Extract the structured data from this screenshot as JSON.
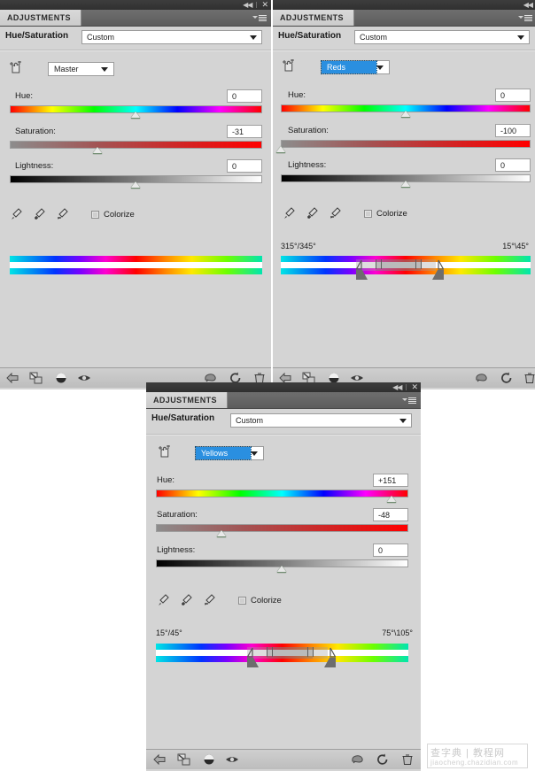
{
  "app": {
    "panel_tab_label": "ADJUSTMENTS",
    "titlebar": {
      "collapse_icon": "collapse-double-arrow-icon",
      "close_icon": "close-icon",
      "collapse_glyph": "◀◀",
      "close_glyph": "✕"
    },
    "panel_menu_icon": "panel-menu-icon"
  },
  "labels": {
    "adjustment_name": "Hue/Saturation",
    "hue": "Hue:",
    "saturation": "Saturation:",
    "lightness": "Lightness:",
    "colorize": "Colorize"
  },
  "icons": {
    "scrubby": "on-image-adjust-hand-icon",
    "eyedropper": "eyedropper-icon",
    "eyedropper_plus": "eyedropper-add-icon",
    "eyedropper_minus": "eyedropper-subtract-icon",
    "back": "return-to-adjustment-list-icon",
    "clip": "clip-to-layer-icon",
    "preview_toggle": "toggle-layer-visibility-icon",
    "eye": "preview-eye-icon",
    "mask": "mask-view-icon",
    "reset": "reset-icon",
    "trash": "delete-layer-icon"
  },
  "colors": {
    "panel_bg": "#d4d4d4",
    "titlebar": "#383838",
    "tab_active": "#d4d4d4",
    "selection_blue": "#2a8fe0",
    "text": "#1a1a1a"
  },
  "panels": [
    {
      "id": "panel-master",
      "preset_value": "Custom",
      "channel_value": "Master",
      "channel_selected": false,
      "hue": {
        "value": "0",
        "thumb_pct": 50
      },
      "saturation": {
        "value": "-31",
        "thumb_pct": 35
      },
      "lightness": {
        "value": "0",
        "thumb_pct": 50
      },
      "colorize_checked": false,
      "range_left_label": "",
      "range_right_label": "",
      "show_range_handles": false
    },
    {
      "id": "panel-reds",
      "preset_value": "Custom",
      "channel_value": "Reds",
      "channel_selected": true,
      "hue": {
        "value": "0",
        "thumb_pct": 50
      },
      "saturation": {
        "value": "-100",
        "thumb_pct": 0
      },
      "lightness": {
        "value": "0",
        "thumb_pct": 50
      },
      "colorize_checked": false,
      "range_left_label": "315°/345°",
      "range_right_label": "15°\\45°",
      "show_range_handles": true,
      "range": {
        "tri_left_pct": 30,
        "bar_start_pct": 38,
        "bar_end_pct": 56,
        "tri_right_pct": 62
      }
    },
    {
      "id": "panel-yellows",
      "preset_value": "Custom",
      "channel_value": "Yellows",
      "channel_selected": true,
      "hue": {
        "value": "+151",
        "thumb_pct": 93
      },
      "saturation": {
        "value": "-48",
        "thumb_pct": 26
      },
      "lightness": {
        "value": "0",
        "thumb_pct": 50
      },
      "colorize_checked": false,
      "range_left_label": "15°/45°",
      "range_right_label": "75°\\105°",
      "show_range_handles": true,
      "range": {
        "tri_left_pct": 36,
        "bar_start_pct": 44,
        "bar_end_pct": 62,
        "tri_right_pct": 68
      }
    }
  ],
  "watermark": {
    "line1": "查字典 | 教程网",
    "line2": "jiaocheng.chazidian.com"
  }
}
